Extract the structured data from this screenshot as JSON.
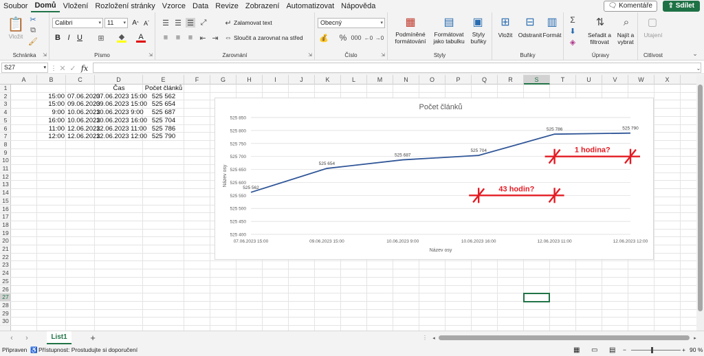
{
  "menu": {
    "items": [
      "Soubor",
      "Domů",
      "Vložení",
      "Rozložení stránky",
      "Vzorce",
      "Data",
      "Revize",
      "Zobrazení",
      "Automatizovat",
      "Nápověda"
    ],
    "active": "Domů",
    "comments_label": "Komentáře",
    "share_label": "Sdílet"
  },
  "ribbon": {
    "clipboard": {
      "label": "Schránka",
      "paste": "Vložit"
    },
    "font": {
      "label": "Písmo",
      "font_name": "Calibri",
      "font_size": "11",
      "bold": "B",
      "italic": "I",
      "underline": "U"
    },
    "alignment": {
      "label": "Zarovnání",
      "wrap_text": "Zalamovat text",
      "merge_center": "Sloučit a zarovnat na střed"
    },
    "number": {
      "label": "Číslo",
      "format": "Obecný",
      "percent": "%"
    },
    "styles": {
      "label": "Styly",
      "conditional": "Podmíněné formátování",
      "format_table": "Formátovat jako tabulku",
      "cell_styles": "Styly buňky"
    },
    "cells": {
      "label": "Buňky",
      "insert": "Vložit",
      "delete": "Odstranit",
      "format": "Formát"
    },
    "editing": {
      "label": "Úpravy",
      "sort_filter": "Seřadit a filtrovat",
      "find_select": "Najít a vybrat"
    },
    "sensitivity": {
      "label": "Citlivost",
      "button": "Utajení"
    }
  },
  "formula_bar": {
    "name_box": "S27",
    "fx": "fx",
    "content": ""
  },
  "columns": [
    "A",
    "B",
    "C",
    "D",
    "E",
    "F",
    "G",
    "H",
    "I",
    "J",
    "K",
    "L",
    "M",
    "N",
    "O",
    "P",
    "Q",
    "R",
    "S",
    "T",
    "U",
    "V",
    "W",
    "X"
  ],
  "selected_column": "S",
  "rows": [
    "1",
    "2",
    "3",
    "4",
    "5",
    "6",
    "7",
    "8",
    "9",
    "10",
    "11",
    "12",
    "13",
    "14",
    "15",
    "16",
    "17",
    "18",
    "19",
    "20",
    "21",
    "22",
    "23",
    "24",
    "25",
    "26",
    "27",
    "28",
    "29",
    "30"
  ],
  "selected_row": "27",
  "table": {
    "headers": {
      "D": "Čas",
      "E": "Počet článků"
    },
    "rows": [
      {
        "B": "15:00",
        "C": "07.06.2023",
        "D": "07.06.2023 15:00",
        "E": "525 562"
      },
      {
        "B": "15:00",
        "C": "09.06.2023",
        "D": "09.06.2023 15:00",
        "E": "525 654"
      },
      {
        "B": "9:00",
        "C": "10.06.2023",
        "D": "10.06.2023 9:00",
        "E": "525 687"
      },
      {
        "B": "16:00",
        "C": "10.06.2023",
        "D": "10.06.2023 16:00",
        "E": "525 704"
      },
      {
        "B": "11:00",
        "C": "12.06.2023",
        "D": "12.06.2023 11:00",
        "E": "525 786"
      },
      {
        "B": "12:00",
        "C": "12.06.2023",
        "D": "12.06.2023 12:00",
        "E": "525 790"
      }
    ]
  },
  "chart_data": {
    "type": "line",
    "title": "Počet článků",
    "xlabel": "Název osy",
    "ylabel": "Název osy",
    "categories": [
      "07.06.2023 15:00",
      "09.06.2023 15:00",
      "10.06.2023 9:00",
      "10.06.2023 16:00",
      "12.06.2023 11:00",
      "12.06.2023 12:00"
    ],
    "values": [
      525562,
      525654,
      525687,
      525704,
      525786,
      525790
    ],
    "data_labels": [
      "525 562",
      "525 654",
      "525 687",
      "525 704",
      "525 786",
      "525 790"
    ],
    "ylim": [
      525400,
      525850
    ],
    "yticks": [
      525400,
      525450,
      525500,
      525550,
      525600,
      525650,
      525700,
      525750,
      525800,
      525850
    ],
    "ytick_labels": [
      "525 400",
      "525 450",
      "525 500",
      "525 550",
      "525 600",
      "525 650",
      "525 700",
      "525 750",
      "525 800",
      "525 850"
    ],
    "line_color": "#2f5597",
    "grid": true,
    "annotations": [
      {
        "text": "1 hodina?",
        "color": "#e31b23"
      },
      {
        "text": "43 hodin?",
        "color": "#e31b23"
      }
    ]
  },
  "sheets": {
    "tabs": [
      "List1"
    ],
    "active": "List1",
    "add": "+"
  },
  "status": {
    "ready": "Připraven",
    "accessibility": "Přístupnost: Prostudujte si doporučení",
    "zoom": "90 %"
  },
  "colors": {
    "accent": "#217346",
    "share": "#1e7145"
  }
}
